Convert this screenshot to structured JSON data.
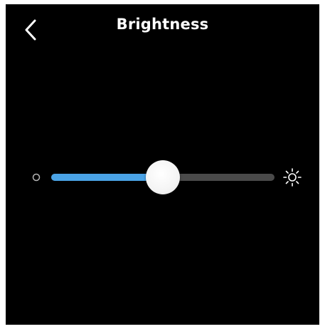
{
  "header": {
    "title": "Brightness",
    "back_icon": "chevron-left-icon"
  },
  "slider": {
    "value": 0.5,
    "min_icon": "dim-circle-icon",
    "max_icon": "sun-icon"
  },
  "colors": {
    "background": "#000000",
    "fill": "#4aa3e6",
    "track": "#4a4a4a",
    "thumb": "#f4f4f4",
    "text": "#ffffff"
  }
}
